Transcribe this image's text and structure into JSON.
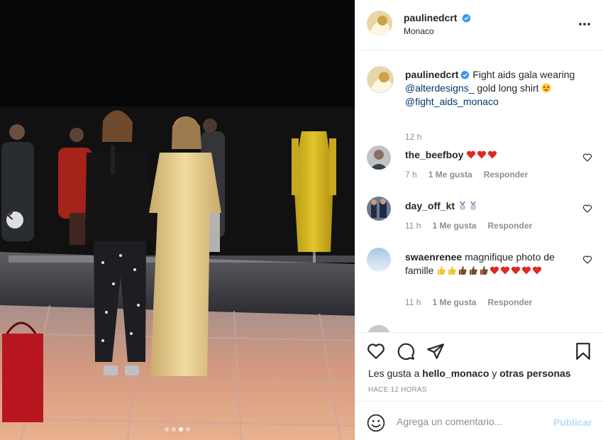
{
  "colors": {
    "accent": "#0095f6",
    "link": "#00376b",
    "like_red": "#ed4956",
    "muted": "#8e8e8e",
    "text": "#262626",
    "verified": "#3897f0"
  },
  "header": {
    "username": "paulinedcrt",
    "location": "Monaco"
  },
  "caption": {
    "username": "paulinedcrt",
    "text_1": "Fight aids gala wearing",
    "mention_1": "@alterdesigns_",
    "text_2": "gold long shirt",
    "emoji": "star-struck",
    "mention_2": "@fight_aids_monaco",
    "time": "12 h"
  },
  "comments": [
    {
      "username": "the_beefboy",
      "text": "",
      "emojis": [
        "red-heart",
        "red-heart",
        "red-heart"
      ],
      "time": "7 h",
      "likes": "1 Me gusta",
      "reply": "Responder"
    },
    {
      "username": "day_off_kt",
      "text": "",
      "emojis": [
        "medal",
        "medal"
      ],
      "time": "11 h",
      "likes": "1 Me gusta",
      "reply": "Responder"
    },
    {
      "username": "swaenrenee",
      "text": "magnifique photo de famille",
      "emojis": [
        "thumbs-up",
        "thumbs-up",
        "thumbs-up-dark",
        "thumbs-up-dark",
        "thumbs-up-dark",
        "heart-revolving",
        "heart-revolving",
        "heart-revolving",
        "heart-revolving",
        "heart-revolving"
      ],
      "time": "11 h",
      "likes": "1 Me gusta",
      "reply": "Responder"
    }
  ],
  "actions": {
    "likes_prefix": "Les gusta a",
    "likes_user": "hello_monaco",
    "likes_mid": "y",
    "likes_others": "otras personas",
    "timestamp": "HACE 12 HORAS"
  },
  "composer": {
    "placeholder": "Agrega un comentario...",
    "publish": "Publicar"
  },
  "carousel": {
    "total": 4,
    "current": 3
  },
  "icons": [
    "verified-badge-icon",
    "more-options-icon",
    "heart-icon",
    "comment-icon",
    "share-icon",
    "bookmark-icon",
    "smile-icon",
    "chevron-left-icon"
  ]
}
